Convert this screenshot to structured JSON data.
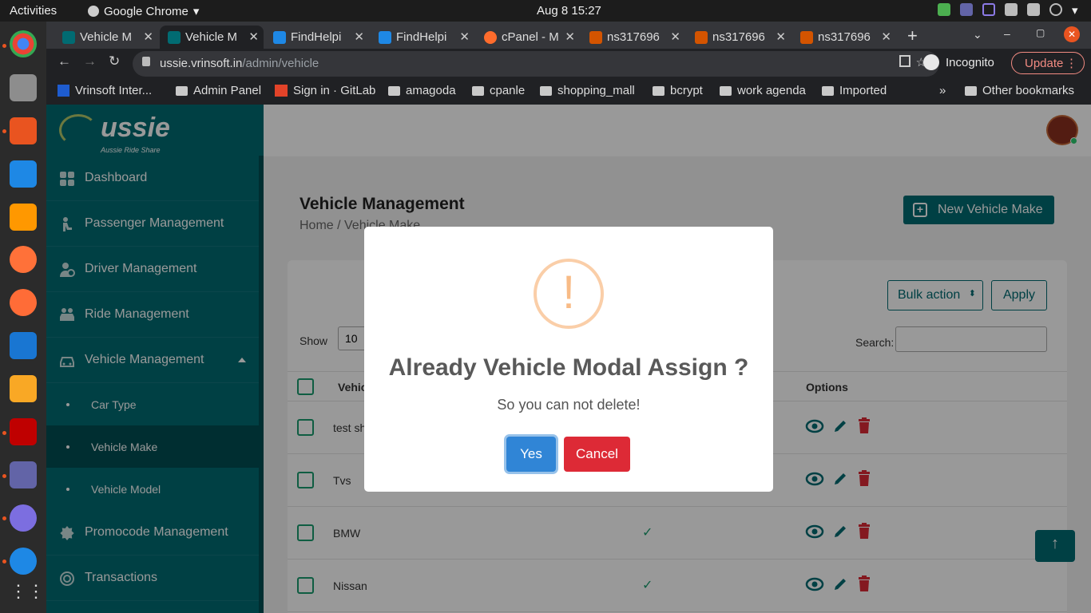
{
  "os": {
    "activities": "Activities",
    "app_name": "Google Chrome",
    "clock": "Aug 8  15:27"
  },
  "browser": {
    "tabs": [
      {
        "label": "Vehicle M",
        "active": false
      },
      {
        "label": "Vehicle M",
        "active": true
      },
      {
        "label": "FindHelpi",
        "active": false
      },
      {
        "label": "FindHelpi",
        "active": false
      },
      {
        "label": "cPanel - M",
        "active": false
      },
      {
        "label": "ns317696",
        "active": false
      },
      {
        "label": "ns317696",
        "active": false
      },
      {
        "label": "ns317696",
        "active": false
      }
    ],
    "url_host": "ussie.vrinsoft.in",
    "url_path": "/admin/vehicle",
    "incognito": "Incognito",
    "update": "Update",
    "bookmarks": [
      "Vrinsoft Inter...",
      "Admin Panel",
      "Sign in · GitLab",
      "amagoda",
      "cpanle",
      "shopping_mall",
      "bcrypt",
      "work agenda",
      "Imported"
    ],
    "other_bookmarks": "Other bookmarks"
  },
  "sidebar": {
    "logo": "ussie",
    "tagline": "Aussie Ride Share",
    "items": [
      {
        "label": "Dashboard",
        "icon": "dashboard-icon"
      },
      {
        "label": "Passenger Management",
        "icon": "passenger-icon"
      },
      {
        "label": "Driver Management",
        "icon": "driver-icon"
      },
      {
        "label": "Ride Management",
        "icon": "ride-icon"
      },
      {
        "label": "Vehicle Management",
        "icon": "car-icon"
      },
      {
        "label": "Promocode Management",
        "icon": "promo-icon"
      },
      {
        "label": "Transactions",
        "icon": "transactions-icon"
      }
    ],
    "subitems": [
      {
        "label": "Car Type"
      },
      {
        "label": "Vehicle Make",
        "active": true
      },
      {
        "label": "Vehicle Model"
      }
    ]
  },
  "main": {
    "title": "Vehicle Management",
    "breadcrumb": "Home  /  Vehicle Make",
    "new_button": "New Vehicle Make",
    "bulk_action": "Bulk action",
    "apply": "Apply",
    "show_label": "Show",
    "show_value": "10",
    "search_label": "Search:",
    "columns": {
      "vehicle": "Vehic",
      "options": "Options"
    },
    "rows": [
      {
        "name": "test sh",
        "status": ""
      },
      {
        "name": "Tvs",
        "status": ""
      },
      {
        "name": "BMW",
        "status": "✓"
      },
      {
        "name": "Nissan",
        "status": "✓"
      }
    ],
    "back_to_top": "↑"
  },
  "modal": {
    "icon": "!",
    "title": "Already Vehicle Modal Assign ?",
    "text": "So you can not delete!",
    "yes": "Yes",
    "cancel": "Cancel"
  }
}
